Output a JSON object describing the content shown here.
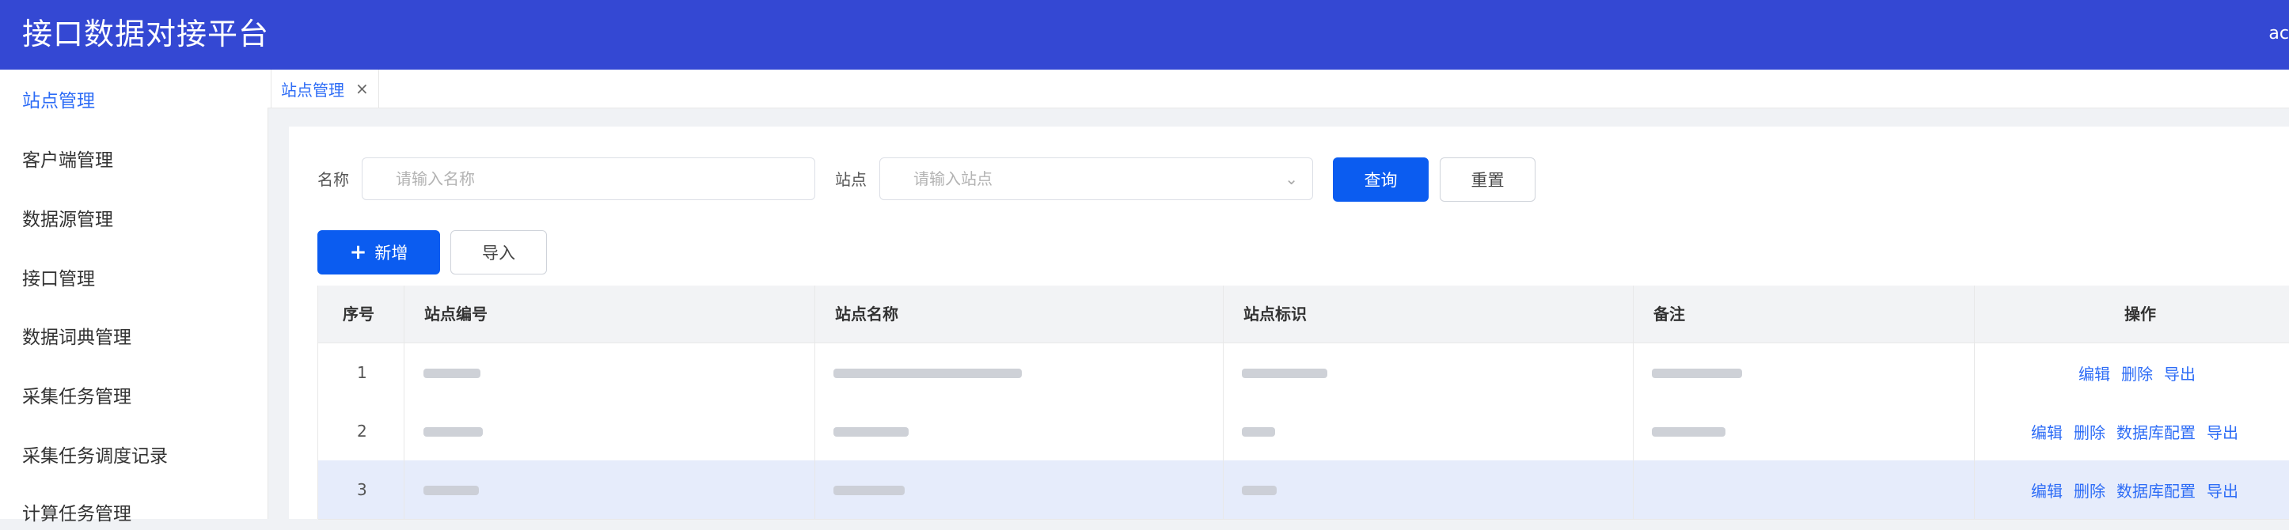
{
  "header": {
    "title": "接口数据对接平台",
    "user": "ac"
  },
  "sidebar": {
    "items": [
      {
        "label": "站点管理",
        "active": true
      },
      {
        "label": "客户端管理"
      },
      {
        "label": "数据源管理"
      },
      {
        "label": "接口管理"
      },
      {
        "label": "数据词典管理"
      },
      {
        "label": "采集任务管理"
      },
      {
        "label": "采集任务调度记录"
      },
      {
        "label": "计算任务管理"
      }
    ]
  },
  "tabs": [
    {
      "label": "站点管理",
      "close": "×"
    }
  ],
  "search": {
    "name_label": "名称",
    "name_placeholder": "请输入名称",
    "site_label": "站点",
    "site_placeholder": "请输入站点",
    "query_label": "查询",
    "reset_label": "重置"
  },
  "toolbar": {
    "add_label": "新增",
    "import_label": "导入"
  },
  "table": {
    "columns": [
      "序号",
      "站点编号",
      "站点名称",
      "站点标识",
      "备注",
      "操作"
    ],
    "rows": [
      {
        "index": "1",
        "actions": [
          "编辑",
          "删除",
          "导出"
        ]
      },
      {
        "index": "2",
        "actions": [
          "编辑",
          "删除",
          "数据库配置",
          "导出"
        ]
      },
      {
        "index": "3",
        "actions": [
          "编辑",
          "删除",
          "数据库配置",
          "导出"
        ]
      }
    ]
  },
  "colors": {
    "header_bg": "#3448d3",
    "primary": "#0b5cf0",
    "link": "#2d6cf6",
    "row_highlight": "#e6ecfb"
  }
}
